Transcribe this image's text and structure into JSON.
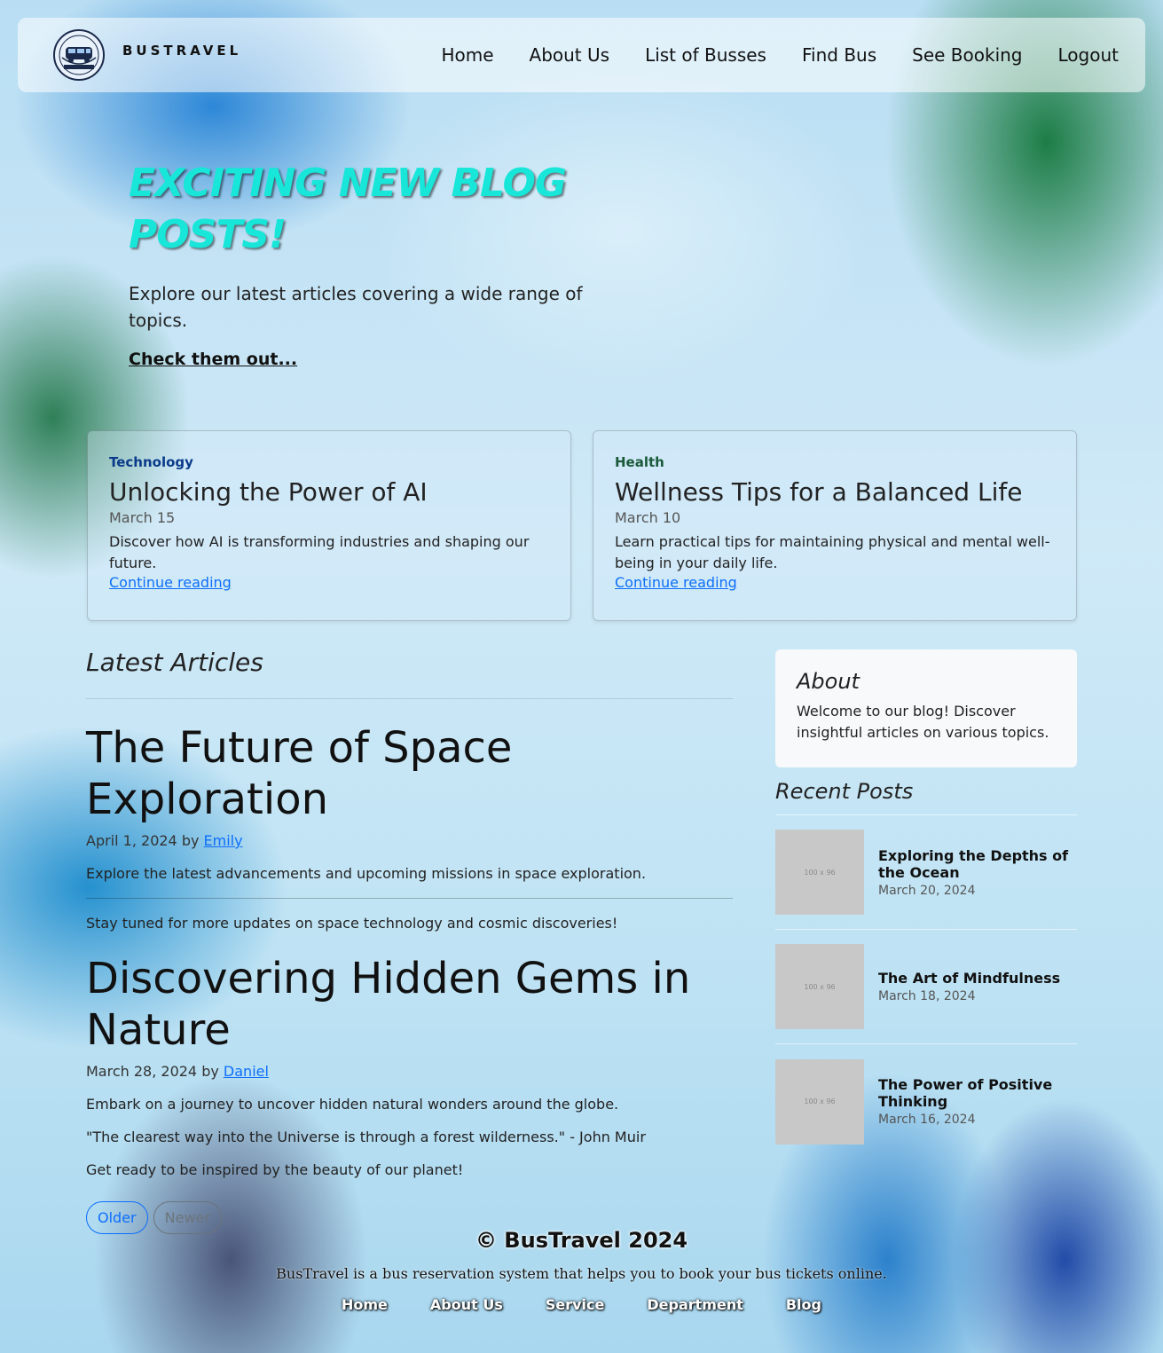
{
  "nav": {
    "brand": "BUSTRAVEL",
    "logo_alt": "logo",
    "links": [
      "Home",
      "About Us",
      "List of Busses",
      "Find Bus",
      "See Booking",
      "Logout"
    ]
  },
  "hero": {
    "title": "EXCITING NEW BLOG POSTS!",
    "subtitle": "Explore our latest articles covering a wide range of topics.",
    "cta": "Check them out..."
  },
  "featured": [
    {
      "category": "Technology",
      "title": "Unlocking the Power of AI",
      "date": "March 15",
      "description": "Discover how AI is transforming industries and shaping our future.",
      "link": "Continue reading"
    },
    {
      "category": "Health",
      "title": "Wellness Tips for a Balanced Life",
      "date": "March 10",
      "description": "Learn practical tips for maintaining physical and mental well-being in your daily life.",
      "link": "Continue reading"
    }
  ],
  "articles": {
    "section_title": "Latest Articles",
    "posts": [
      {
        "title": "The Future of Space Exploration",
        "date": "April 1, 2024 by",
        "author": "Emily",
        "summary": "Explore the latest advancements and upcoming missions in space exploration.",
        "closing": "Stay tuned for more updates on space technology and cosmic discoveries!"
      },
      {
        "title": "Discovering Hidden Gems in Nature",
        "date": "March 28, 2024 by",
        "author": "Daniel",
        "summary": "Embark on a journey to uncover hidden natural wonders around the globe.",
        "quote": "\"The clearest way into the Universe is through a forest wilderness.\" - John Muir",
        "closing": "Get ready to be inspired by the beauty of our planet!"
      }
    ],
    "pager": {
      "older": "Older",
      "newer": "Newer"
    }
  },
  "sidebar": {
    "about_title": "About",
    "about_text": "Welcome to our blog! Discover insightful articles on various topics.",
    "recent_title": "Recent Posts",
    "thumb_label": "100 x 96",
    "recent": [
      {
        "title": "Exploring the Depths of the Ocean",
        "date": "March 20, 2024"
      },
      {
        "title": "The Art of Mindfulness",
        "date": "March 18, 2024"
      },
      {
        "title": "The Power of Positive Thinking",
        "date": "March 16, 2024"
      }
    ]
  },
  "footer": {
    "copyright": "© BusTravel 2024",
    "tagline": "BusTravel is a bus reservation system that helps you to book your bus tickets online.",
    "links": [
      "Home",
      "About Us",
      "Service",
      "Department",
      "Blog"
    ]
  }
}
